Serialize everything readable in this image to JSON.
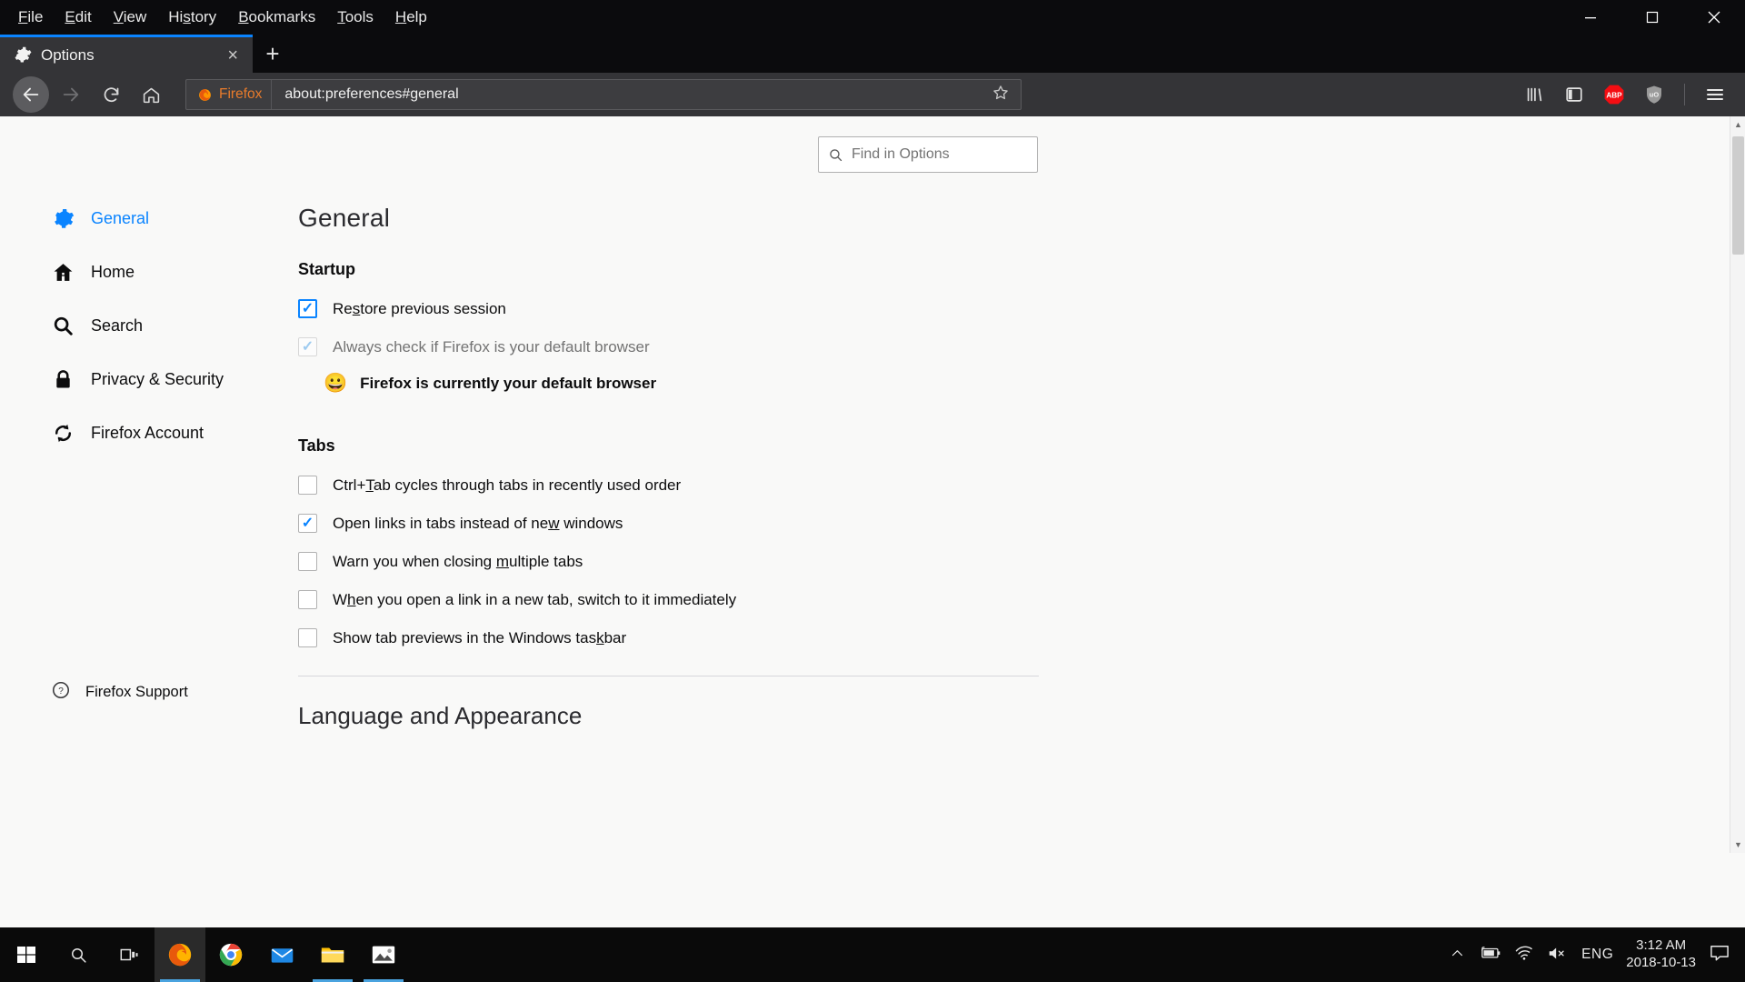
{
  "menubar": {
    "items": [
      {
        "label": "File",
        "accesskey": "F"
      },
      {
        "label": "Edit",
        "accesskey": "E"
      },
      {
        "label": "View",
        "accesskey": "V"
      },
      {
        "label": "History",
        "accesskey": "s"
      },
      {
        "label": "Bookmarks",
        "accesskey": "B"
      },
      {
        "label": "Tools",
        "accesskey": "T"
      },
      {
        "label": "Help",
        "accesskey": "H"
      }
    ],
    "window_controls": {
      "minimize": "minimize-icon",
      "maximize": "restore-icon",
      "close": "close-icon"
    }
  },
  "tabstrip": {
    "tab": {
      "title": "Options",
      "icon": "gear-icon",
      "close": "×"
    },
    "newtab_label": "+"
  },
  "navbar": {
    "back_icon": "back-arrow-icon",
    "forward_icon": "forward-arrow-icon",
    "reload_icon": "reload-icon",
    "home_icon": "home-icon",
    "identity_label": "Firefox",
    "url": "about:preferences#general",
    "bookmark_icon": "star-icon",
    "library_icon": "library-icon",
    "sidebar_icon": "sidebar-icon",
    "adblock_label": "ABP",
    "ublock_label": "uO",
    "menu_icon": "hamburger-menu-icon",
    "accent": "#0a84ff"
  },
  "search": {
    "placeholder": "Find in Options",
    "icon": "search-icon"
  },
  "sidebar": {
    "items": [
      {
        "label": "General",
        "icon": "gear-icon",
        "active": true
      },
      {
        "label": "Home",
        "icon": "home-icon",
        "active": false
      },
      {
        "label": "Search",
        "icon": "magnifier-icon",
        "active": false
      },
      {
        "label": "Privacy & Security",
        "icon": "lock-icon",
        "active": false
      },
      {
        "label": "Firefox Account",
        "icon": "sync-icon",
        "active": false
      }
    ],
    "support": {
      "label": "Firefox Support",
      "icon": "help-circle-icon"
    }
  },
  "main": {
    "title": "General",
    "startup": {
      "heading": "Startup",
      "restore": {
        "pre": "Re",
        "key": "s",
        "post": "tore previous session",
        "checked": true,
        "disabled": false
      },
      "always_check": {
        "pre": "Always check if Firefox is your default browser",
        "key": "",
        "post": "",
        "checked": true,
        "disabled": true
      },
      "default_message": "Firefox is currently your default browser",
      "default_emoji": "😀"
    },
    "tabs": {
      "heading": "Tabs",
      "options": [
        {
          "pre": "Ctrl+",
          "key": "T",
          "post": "ab cycles through tabs in recently used order",
          "checked": false
        },
        {
          "pre": "Open links in tabs instead of ne",
          "key": "w",
          "post": " windows",
          "checked": true
        },
        {
          "pre": "Warn you when closing ",
          "key": "m",
          "post": "ultiple tabs",
          "checked": false
        },
        {
          "pre": "W",
          "key": "h",
          "post": "en you open a link in a new tab, switch to it immediately",
          "checked": false
        },
        {
          "pre": "Show tab previews in the Windows tas",
          "key": "k",
          "post": "bar",
          "checked": false
        }
      ]
    },
    "next_section": "Language and Appearance"
  },
  "taskbar": {
    "start_icon": "windows-start-icon",
    "search_icon": "taskbar-search-icon",
    "taskview_icon": "task-view-icon",
    "apps": [
      {
        "name": "firefox-taskbar-icon",
        "running": true,
        "active": true
      },
      {
        "name": "chrome-taskbar-icon",
        "running": false,
        "active": false
      },
      {
        "name": "mail-taskbar-icon",
        "running": false,
        "active": false
      },
      {
        "name": "file-explorer-taskbar-icon",
        "running": true,
        "active": false
      },
      {
        "name": "photos-taskbar-icon",
        "running": true,
        "active": false
      }
    ],
    "tray": {
      "chevron": "show-hidden-icons-icon",
      "battery": "battery-charging-icon",
      "network": "wifi-icon",
      "volume": "volume-muted-icon",
      "language": "ENG",
      "time": "3:12 AM",
      "date": "2018-10-13",
      "action_center": "notifications-icon"
    }
  }
}
